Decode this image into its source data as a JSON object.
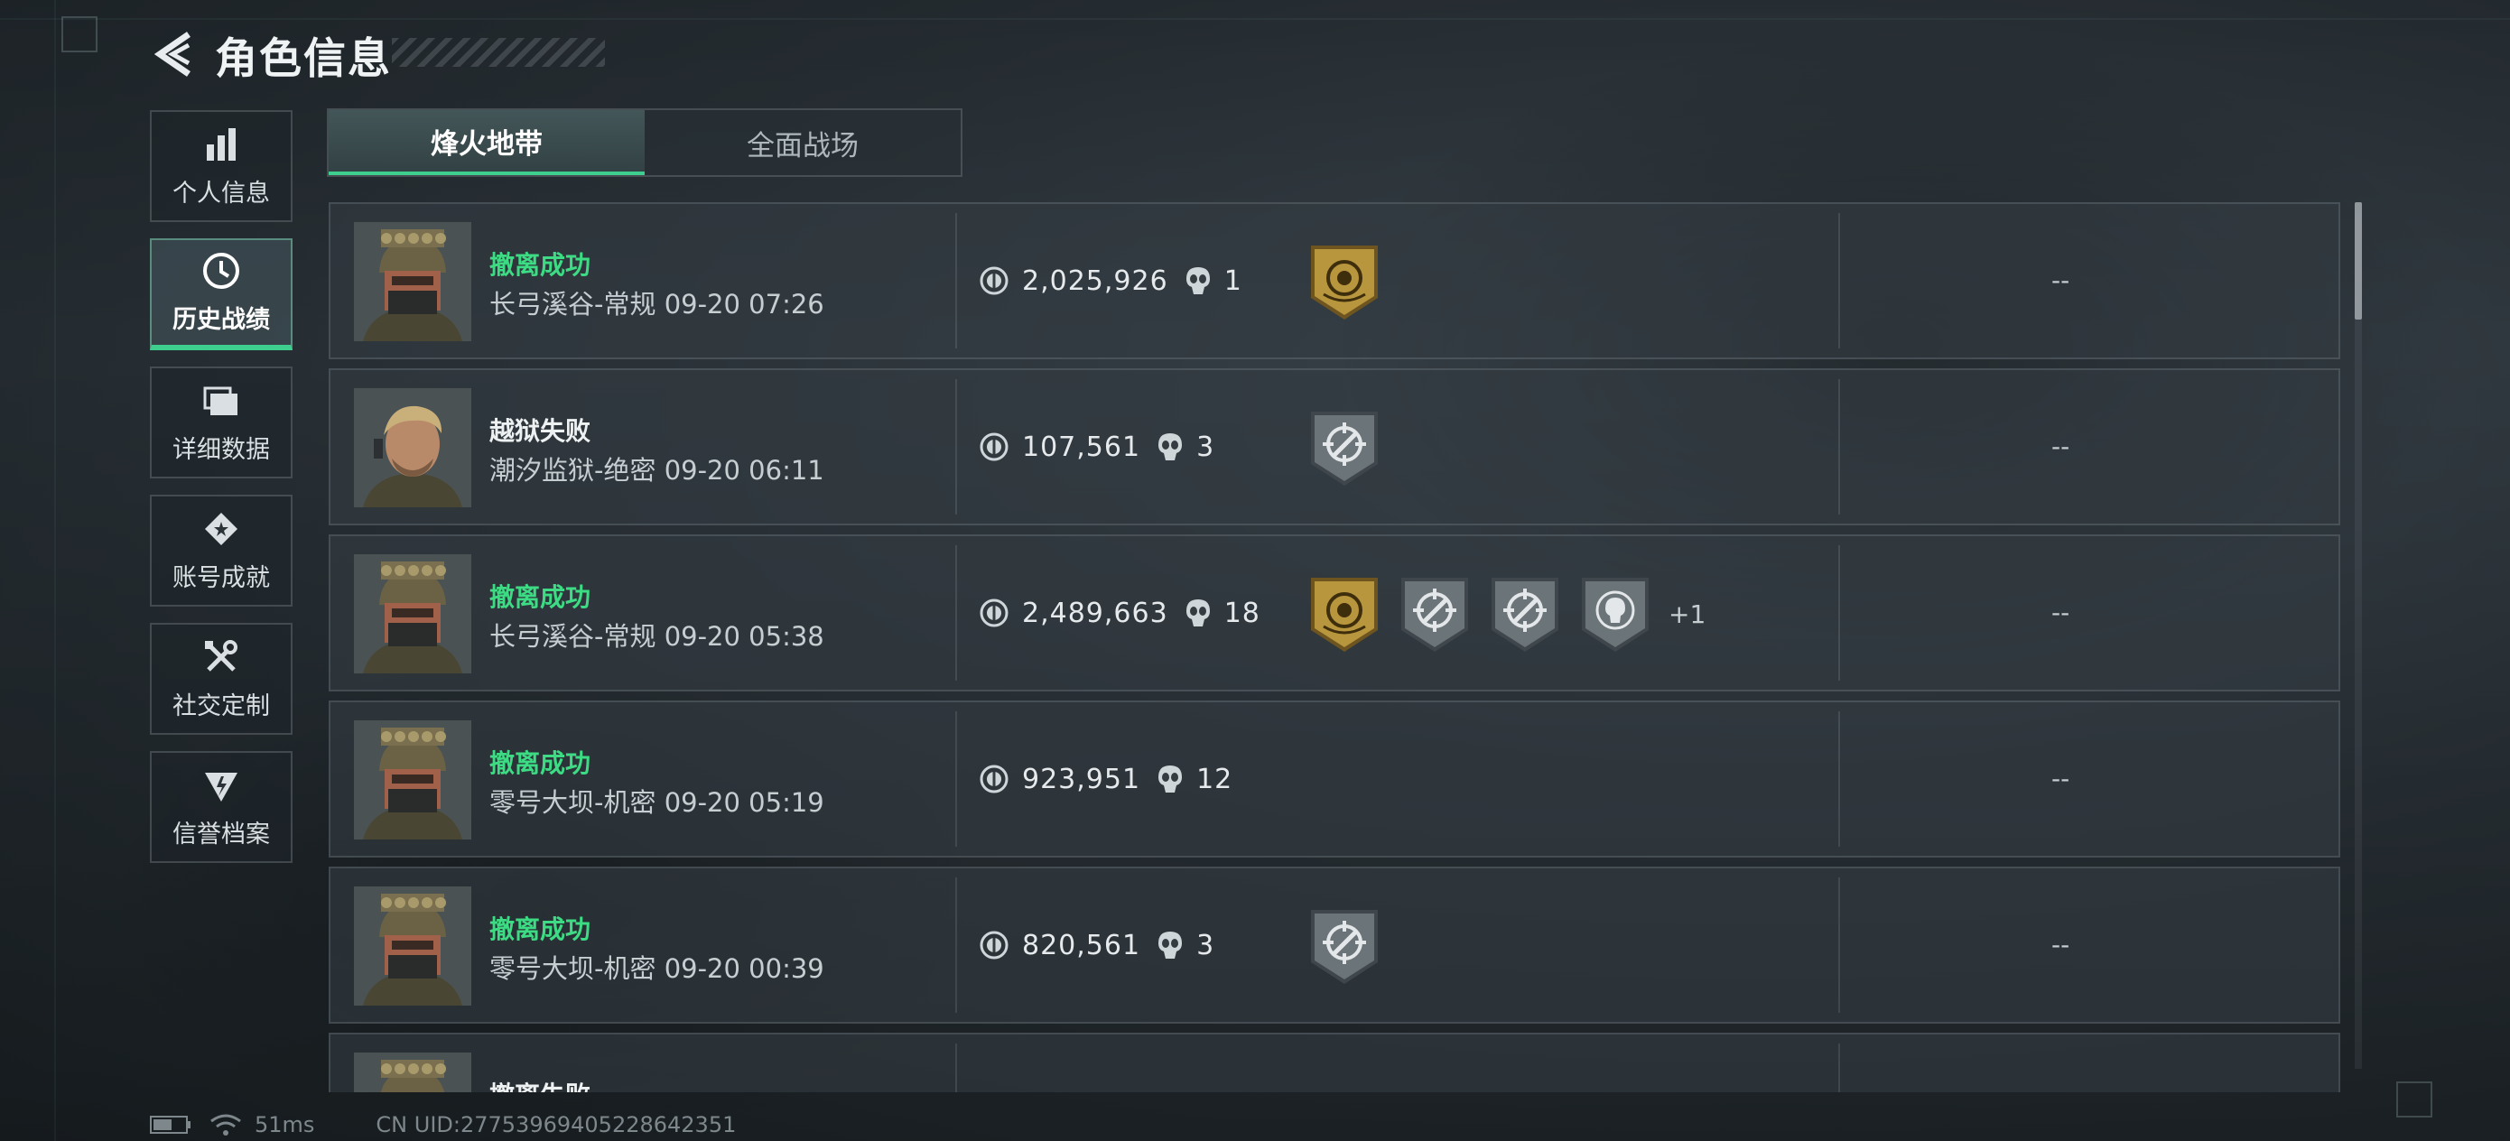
{
  "header": {
    "title": "角色信息"
  },
  "sidebar": {
    "items": [
      {
        "label": "个人信息",
        "icon": "bar-chart-icon"
      },
      {
        "label": "历史战绩",
        "icon": "clock-icon",
        "active": true
      },
      {
        "label": "详细数据",
        "icon": "folders-icon"
      },
      {
        "label": "账号成就",
        "icon": "achievement-icon"
      },
      {
        "label": "社交定制",
        "icon": "tools-icon"
      },
      {
        "label": "信誉档案",
        "icon": "reputation-icon"
      }
    ]
  },
  "tabs": [
    {
      "label": "烽火地带",
      "active": true
    },
    {
      "label": "全面战场",
      "active": false
    }
  ],
  "records": [
    {
      "status": "撤离成功",
      "result": "success",
      "map": "长弓溪谷-常规",
      "time": "09-20 07:26",
      "value": "2,025,926",
      "kills": "1",
      "badges": [
        "gold"
      ],
      "more": "",
      "extra": "--",
      "avatar": "helmet-operator"
    },
    {
      "status": "越狱失败",
      "result": "fail",
      "map": "潮汐监狱-绝密",
      "time": "09-20 06:11",
      "value": "107,561",
      "kills": "3",
      "badges": [
        "crosshair"
      ],
      "more": "",
      "extra": "--",
      "avatar": "blond-operator"
    },
    {
      "status": "撤离成功",
      "result": "success",
      "map": "长弓溪谷-常规",
      "time": "09-20 05:38",
      "value": "2,489,663",
      "kills": "18",
      "badges": [
        "gold",
        "crosshair",
        "crosshair",
        "skull"
      ],
      "more": "+1",
      "extra": "--",
      "avatar": "helmet-operator"
    },
    {
      "status": "撤离成功",
      "result": "success",
      "map": "零号大坝-机密",
      "time": "09-20 05:19",
      "value": "923,951",
      "kills": "12",
      "badges": [],
      "more": "",
      "extra": "--",
      "avatar": "helmet-operator"
    },
    {
      "status": "撤离成功",
      "result": "success",
      "map": "零号大坝-机密",
      "time": "09-20 00:39",
      "value": "820,561",
      "kills": "3",
      "badges": [
        "crosshair"
      ],
      "more": "",
      "extra": "--",
      "avatar": "helmet-operator"
    },
    {
      "status": "撤离失败",
      "result": "fail",
      "map": "",
      "time": "",
      "value": "",
      "kills": "",
      "badges": [],
      "more": "",
      "extra": "",
      "avatar": "helmet-operator"
    }
  ],
  "footer": {
    "ping": "51ms",
    "uid": "CN UID:27753969405228642351"
  },
  "colors": {
    "accent": "#3ecf8e",
    "success": "#3ddc84",
    "gold": "#b8963e"
  }
}
